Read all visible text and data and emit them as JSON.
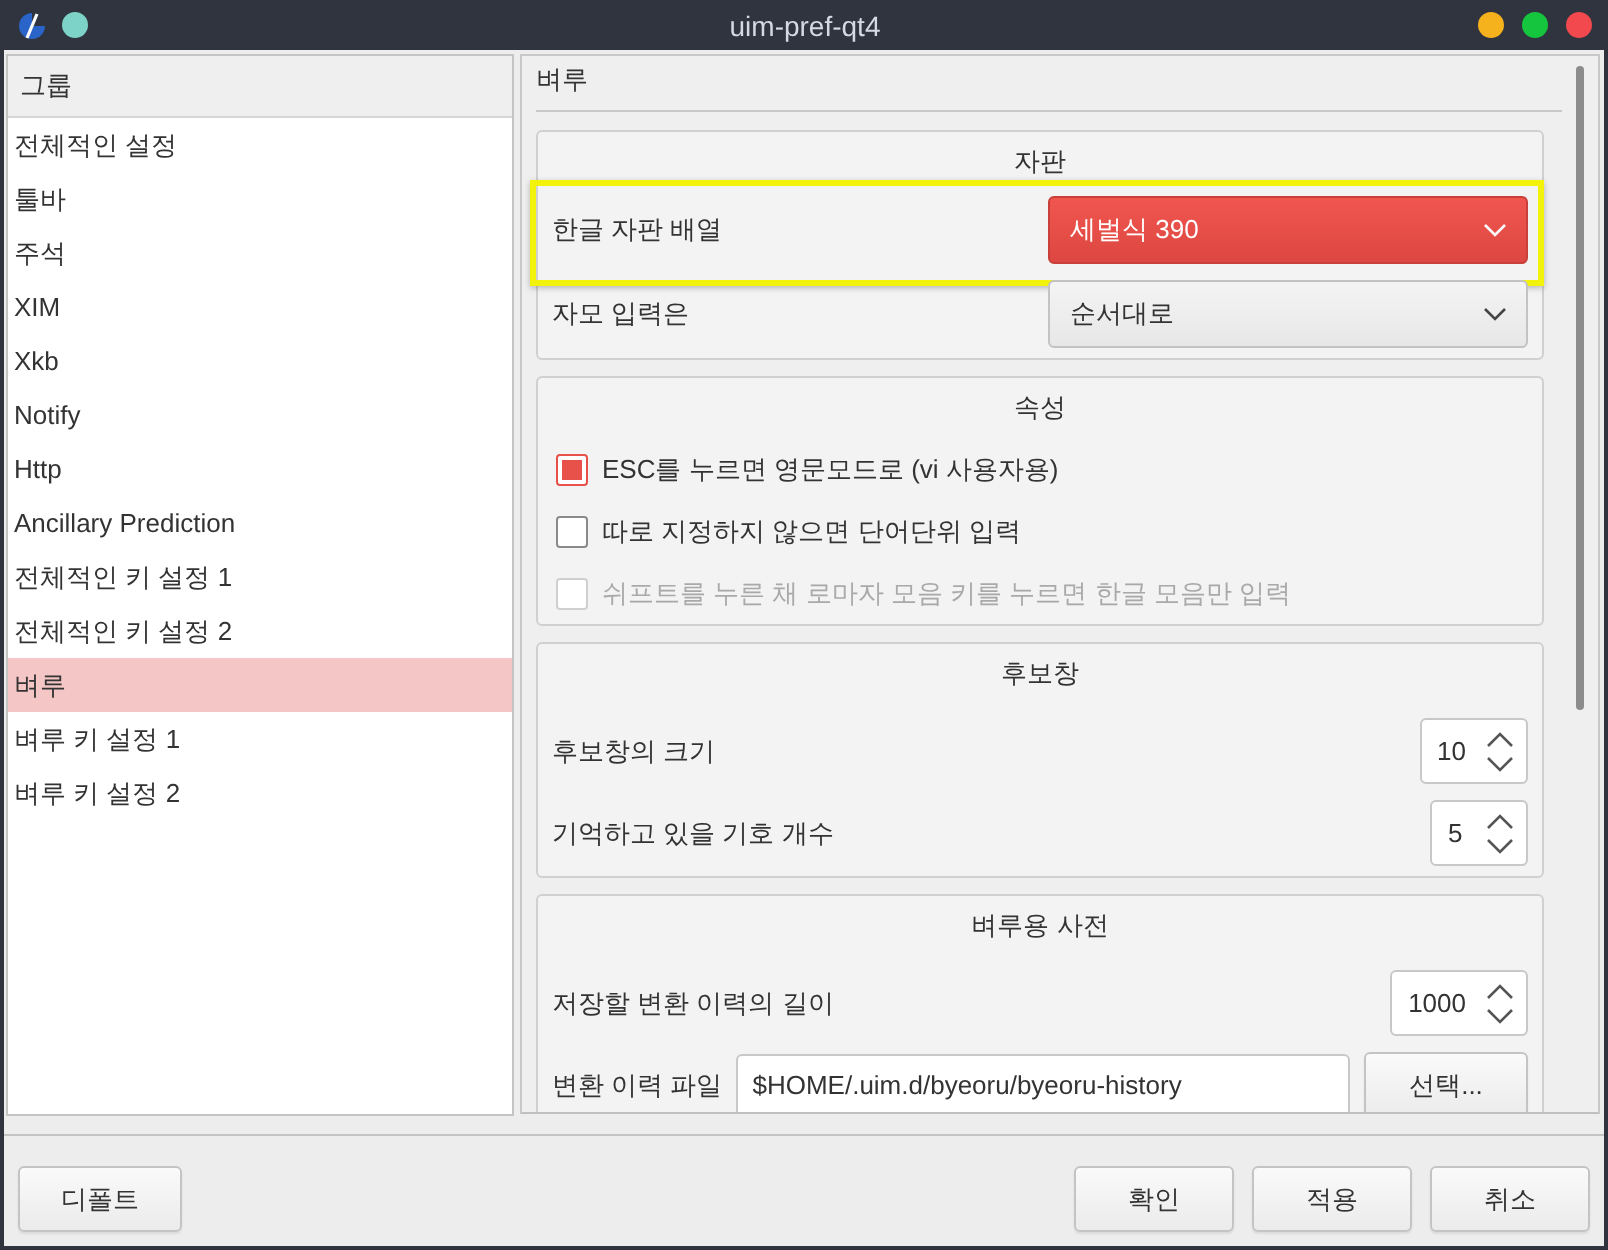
{
  "window": {
    "title": "uim-pref-qt4"
  },
  "sidebar": {
    "header": "그룹",
    "items": [
      {
        "label": "전체적인 설정",
        "selected": false
      },
      {
        "label": "툴바",
        "selected": false
      },
      {
        "label": "주석",
        "selected": false
      },
      {
        "label": "XIM",
        "selected": false
      },
      {
        "label": "Xkb",
        "selected": false
      },
      {
        "label": "Notify",
        "selected": false
      },
      {
        "label": "Http",
        "selected": false
      },
      {
        "label": "Ancillary Prediction",
        "selected": false
      },
      {
        "label": "전체적인 키 설정 1",
        "selected": false
      },
      {
        "label": "전체적인 키 설정 2",
        "selected": false
      },
      {
        "label": "벼루",
        "selected": true
      },
      {
        "label": "벼루 키 설정 1",
        "selected": false
      },
      {
        "label": "벼루 키 설정 2",
        "selected": false
      }
    ]
  },
  "page": {
    "title": "벼루",
    "groups": [
      {
        "title": "자판",
        "rows": [
          {
            "kind": "combo",
            "label": "한글 자판 배열",
            "value": "세벌식 390",
            "active": true,
            "highlighted": true
          },
          {
            "kind": "combo",
            "label": "자모 입력은",
            "value": "순서대로",
            "active": false,
            "highlighted": false
          }
        ]
      },
      {
        "title": "속성",
        "rows": [
          {
            "kind": "checkbox",
            "label": "ESC를 누르면 영문모드로 (vi 사용자용)",
            "checked": true,
            "disabled": false
          },
          {
            "kind": "checkbox",
            "label": "따로 지정하지 않으면 단어단위 입력",
            "checked": false,
            "disabled": false
          },
          {
            "kind": "checkbox",
            "label": "쉬프트를 누른 채 로마자 모음 키를 누르면 한글 모음만 입력",
            "checked": false,
            "disabled": true
          }
        ]
      },
      {
        "title": "후보창",
        "rows": [
          {
            "kind": "spin",
            "label": "후보창의 크기",
            "value": "10"
          },
          {
            "kind": "spin",
            "label": "기억하고 있을 기호 개수",
            "value": "5"
          }
        ]
      },
      {
        "title": "벼루용 사전",
        "rows": [
          {
            "kind": "spin",
            "label": "저장할 변환 이력의 길이",
            "value": "1000"
          },
          {
            "kind": "file",
            "label": "변환 이력 파일",
            "value": "$HOME/.uim.d/byeoru/byeoru-history",
            "button": "선택..."
          }
        ]
      }
    ]
  },
  "footer": {
    "left_buttons": [
      "디폴트"
    ],
    "right_buttons": [
      "확인",
      "적용",
      "취소"
    ]
  }
}
